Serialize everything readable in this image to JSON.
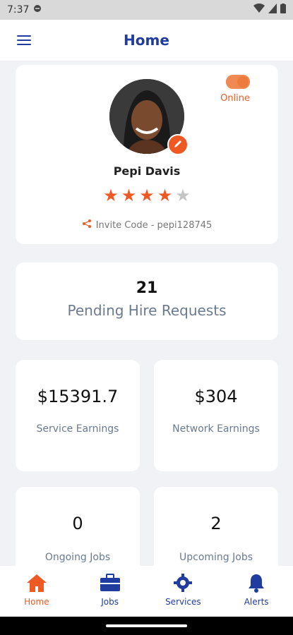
{
  "status_bar": {
    "time": "7:37"
  },
  "header": {
    "title": "Home"
  },
  "profile": {
    "status_label": "Online",
    "name": "Pepi Davis",
    "rating": 4,
    "rating_max": 5,
    "invite_text": "Invite Code - pepi128745"
  },
  "pending": {
    "count": "21",
    "label": "Pending Hire Requests"
  },
  "stats": {
    "service_earnings": {
      "value": "$15391.7",
      "label": "Service Earnings"
    },
    "network_earnings": {
      "value": "$304",
      "label": "Network Earnings"
    },
    "ongoing_jobs": {
      "value": "0",
      "label": "Ongoing Jobs"
    },
    "upcoming_jobs": {
      "value": "2",
      "label": "Upcoming Jobs"
    }
  },
  "bottom_nav": {
    "items": [
      {
        "label": "Home",
        "icon": "home-icon",
        "active": true
      },
      {
        "label": "Jobs",
        "icon": "briefcase-icon",
        "active": false
      },
      {
        "label": "Services",
        "icon": "gear-icon",
        "active": false
      },
      {
        "label": "Alerts",
        "icon": "bell-icon",
        "active": false
      }
    ]
  },
  "colors": {
    "accent": "#ef5a24",
    "primary": "#1f3c9e",
    "background": "#f0f2f6"
  }
}
